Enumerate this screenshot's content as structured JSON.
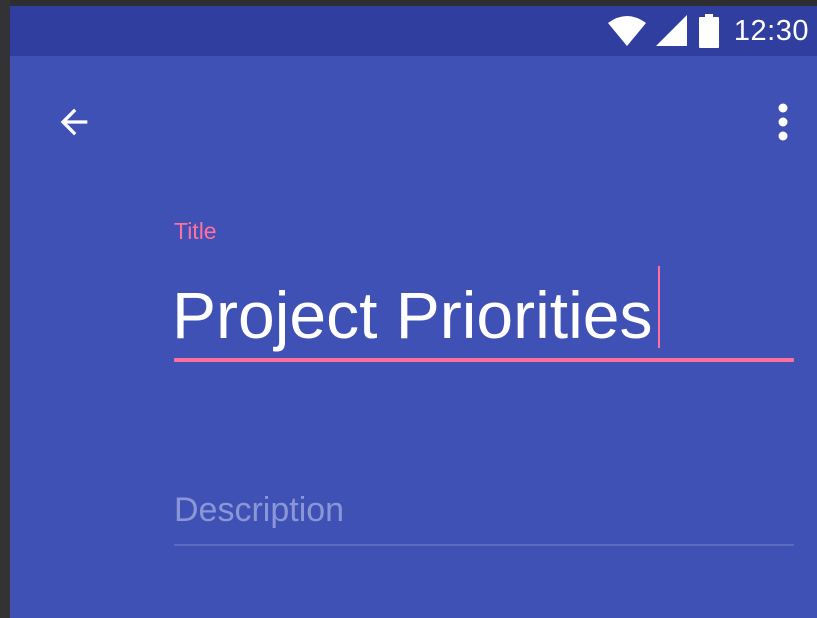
{
  "status_bar": {
    "time": "12:30",
    "icons": [
      "wifi-icon",
      "signal-icon",
      "battery-icon"
    ]
  },
  "toolbar": {
    "back_icon": "arrow-back-icon",
    "menu_icon": "more-vert-icon"
  },
  "title_field": {
    "label": "Title",
    "value": "Project Priorities"
  },
  "description_field": {
    "placeholder": "Description",
    "value": ""
  },
  "colors": {
    "primary": "#3f51b5",
    "primary_dark": "#303f9f",
    "accent": "#ff6f9f",
    "text_light": "#ffffff",
    "hint": "#8a96d6"
  }
}
